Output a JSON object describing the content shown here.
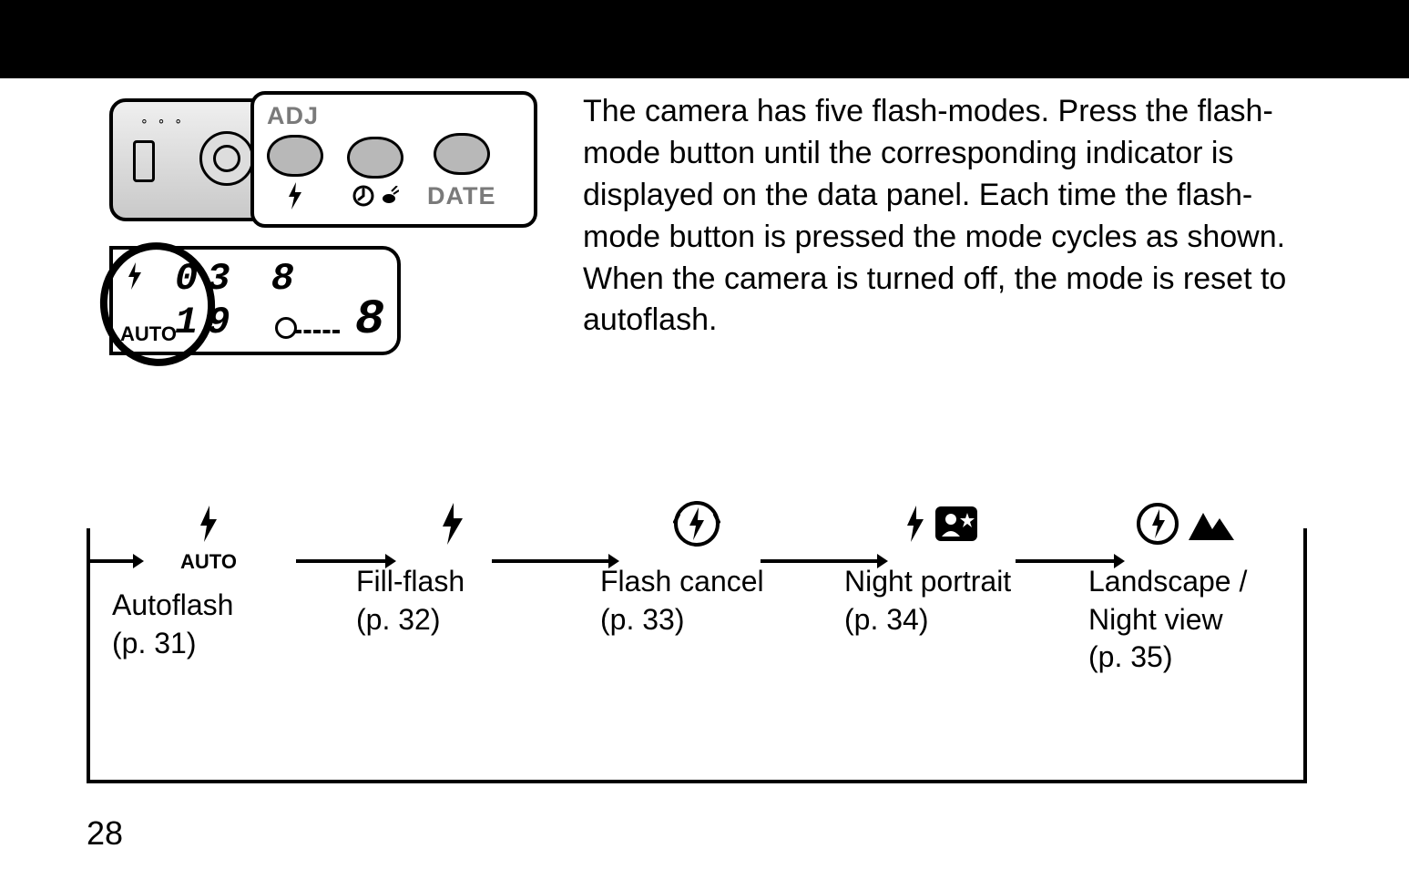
{
  "header": {
    "title": ""
  },
  "button_panel": {
    "adj_label": "ADJ",
    "date_label": "DATE"
  },
  "lcd": {
    "segment_top": "03  8  19",
    "segment_big": "8",
    "auto_label": "AUTO"
  },
  "body": {
    "paragraph": "The camera has five flash-modes. Press the flash-mode button until the corresponding indicator is displayed on the data panel. Each time the flash-mode button is pressed the mode cycles as shown. When the camera is turned off, the mode is reset to autoflash."
  },
  "modes": [
    {
      "icon": "flash-auto",
      "auto_text": "AUTO",
      "label": "Autoflash",
      "page": "(p. 31)"
    },
    {
      "icon": "flash-fill",
      "auto_text": "",
      "label": "Fill-flash",
      "page": "(p. 32)"
    },
    {
      "icon": "flash-cancel",
      "auto_text": "",
      "label": "Flash cancel",
      "page": "(p. 33)"
    },
    {
      "icon": "night-portrait",
      "auto_text": "",
      "label": "Night portrait",
      "page": "(p. 34)"
    },
    {
      "icon": "landscape-night",
      "auto_text": "",
      "label": "Landscape / Night view",
      "page": "(p. 35)"
    }
  ],
  "page_number": "28"
}
